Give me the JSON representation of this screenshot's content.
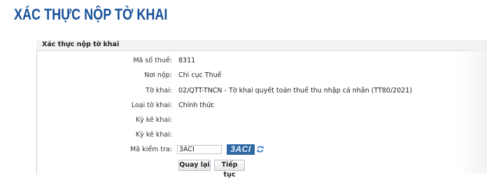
{
  "header": {
    "title": "XÁC THỰC NỘP TỜ KHAI"
  },
  "panel": {
    "title": "Xác thực nộp tờ khai",
    "fields": [
      {
        "label": "Mã số thuế:",
        "value": "8311"
      },
      {
        "label": "Nơi nộp:",
        "value": "Chi cục Thuế"
      },
      {
        "label": "Tờ khai:",
        "value": "02/QTT-TNCN - Tờ khai quyết toán thuế thu nhập cá nhân (TT80/2021)"
      },
      {
        "label": "Loại tờ khai:",
        "value": "Chính thức"
      },
      {
        "label": "Kỳ kê khai:",
        "value": ""
      },
      {
        "label": "Kỳ kê khai:",
        "value": ""
      }
    ],
    "captcha": {
      "label": "Mã kiểm tra:",
      "input_value": "3ACI",
      "image_text": "3ACI",
      "refresh_icon": "refresh-icon"
    },
    "buttons": {
      "back": "Quay lại",
      "next": "Tiếp tục"
    }
  },
  "colors": {
    "title": "#17509a",
    "captcha_bg": "#2e67a2"
  }
}
